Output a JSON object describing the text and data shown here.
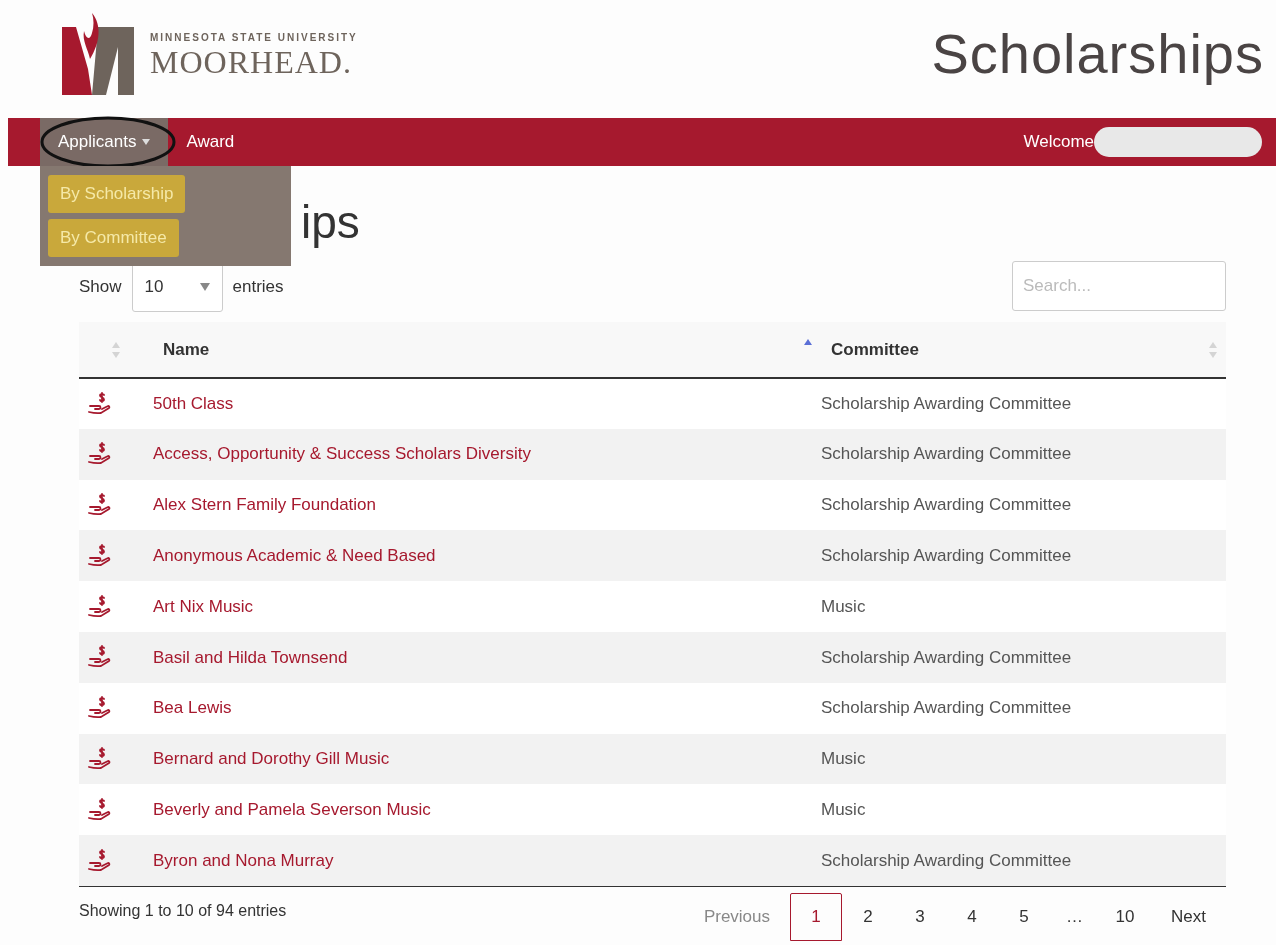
{
  "logo": {
    "tagline": "MINNESOTA STATE UNIVERSITY",
    "name": "MOORHEAD."
  },
  "site_title": "Scholarships",
  "nav": {
    "items": [
      {
        "label": "Applicants",
        "dropdown": true,
        "selected": true,
        "circled": true,
        "menu": [
          {
            "label": "By Scholarship",
            "highlighted": true
          },
          {
            "label": "By Committee",
            "highlighted": true
          }
        ]
      },
      {
        "label": "Award",
        "dropdown": false,
        "selected": false,
        "circled": false
      }
    ],
    "welcome": "Welcome"
  },
  "page_title": "ips",
  "length": {
    "prefix": "Show",
    "value": "10",
    "suffix": "entries"
  },
  "search": {
    "placeholder": "Search..."
  },
  "table": {
    "columns": [
      {
        "sorted": false
      },
      {
        "label": "Name",
        "sorted": true
      },
      {
        "label": "Committee",
        "sorted": false
      }
    ],
    "rows": [
      {
        "name": "50th Class",
        "committee": "Scholarship Awarding Committee"
      },
      {
        "name": "Access, Opportunity & Success Scholars Diversity",
        "committee": "Scholarship Awarding Committee"
      },
      {
        "name": "Alex Stern Family Foundation",
        "committee": "Scholarship Awarding Committee"
      },
      {
        "name": "Anonymous Academic & Need Based",
        "committee": "Scholarship Awarding Committee"
      },
      {
        "name": "Art Nix Music",
        "committee": "Music"
      },
      {
        "name": "Basil and Hilda Townsend",
        "committee": "Scholarship Awarding Committee"
      },
      {
        "name": "Bea Lewis",
        "committee": "Scholarship Awarding Committee"
      },
      {
        "name": "Bernard and Dorothy Gill Music",
        "committee": "Music"
      },
      {
        "name": "Beverly and Pamela Severson Music",
        "committee": "Music"
      },
      {
        "name": "Byron and Nona Murray",
        "committee": "Scholarship Awarding Committee"
      }
    ]
  },
  "info": "Showing 1 to 10 of 94 entries",
  "pagination": [
    {
      "kind": "prev",
      "label": "Previous",
      "disabled": true
    },
    {
      "kind": "page",
      "label": "1",
      "selected": true
    },
    {
      "kind": "page",
      "label": "2",
      "selected": false
    },
    {
      "kind": "page",
      "label": "3",
      "selected": false
    },
    {
      "kind": "page",
      "label": "4",
      "selected": false
    },
    {
      "kind": "page",
      "label": "5",
      "selected": false
    },
    {
      "kind": "ellipsis",
      "label": "…"
    },
    {
      "kind": "page",
      "label": "10",
      "selected": false
    },
    {
      "kind": "next",
      "label": "Next",
      "disabled": false
    }
  ]
}
